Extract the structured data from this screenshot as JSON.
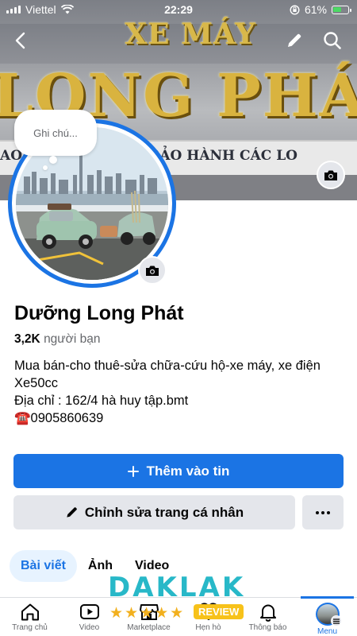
{
  "status_bar": {
    "carrier": "Viettel",
    "time": "22:29",
    "battery": "61%",
    "battery_level": 0.61
  },
  "cover": {
    "sign_top": "XE MÁY",
    "sign_main": "LONG PHÁT",
    "sign_sub": "AO - THUÊ - TRẠM BẢO HÀNH CÁC LO"
  },
  "note": {
    "placeholder": "Ghi chú..."
  },
  "profile": {
    "name": "Dưỡng Long Phát",
    "friends_count": "3,2K",
    "friends_label": "người bạn",
    "bio": [
      "Mua bán-cho thuê-sửa chữa-cứu hộ-xe máy, xe điện",
      "Xe50cc",
      "Địa chỉ : 162/4 hà huy tập.bmt",
      "☎️0905860639"
    ]
  },
  "actions": {
    "add_story": "Thêm vào tin",
    "edit_profile": "Chỉnh sửa trang cá nhân"
  },
  "tabs": [
    {
      "label": "Bài viết",
      "active": true
    },
    {
      "label": "Ảnh",
      "active": false
    },
    {
      "label": "Video",
      "active": false
    }
  ],
  "nav": [
    {
      "label": "Trang chủ",
      "icon": "home-icon"
    },
    {
      "label": "Video",
      "icon": "video-icon"
    },
    {
      "label": "Marketplace",
      "icon": "marketplace-icon"
    },
    {
      "label": "Hẹn hò",
      "icon": "heart-icon"
    },
    {
      "label": "Thông báo",
      "icon": "bell-icon"
    },
    {
      "label": "Menu",
      "icon": "menu-avatar",
      "active": true
    }
  ],
  "watermark": {
    "title": "DAKLAK",
    "stars": "★★★★★",
    "badge": "REVIEW"
  },
  "colors": {
    "accent": "#1b74e4",
    "secondary_button": "#e4e6eb",
    "muted_text": "#65676b"
  }
}
